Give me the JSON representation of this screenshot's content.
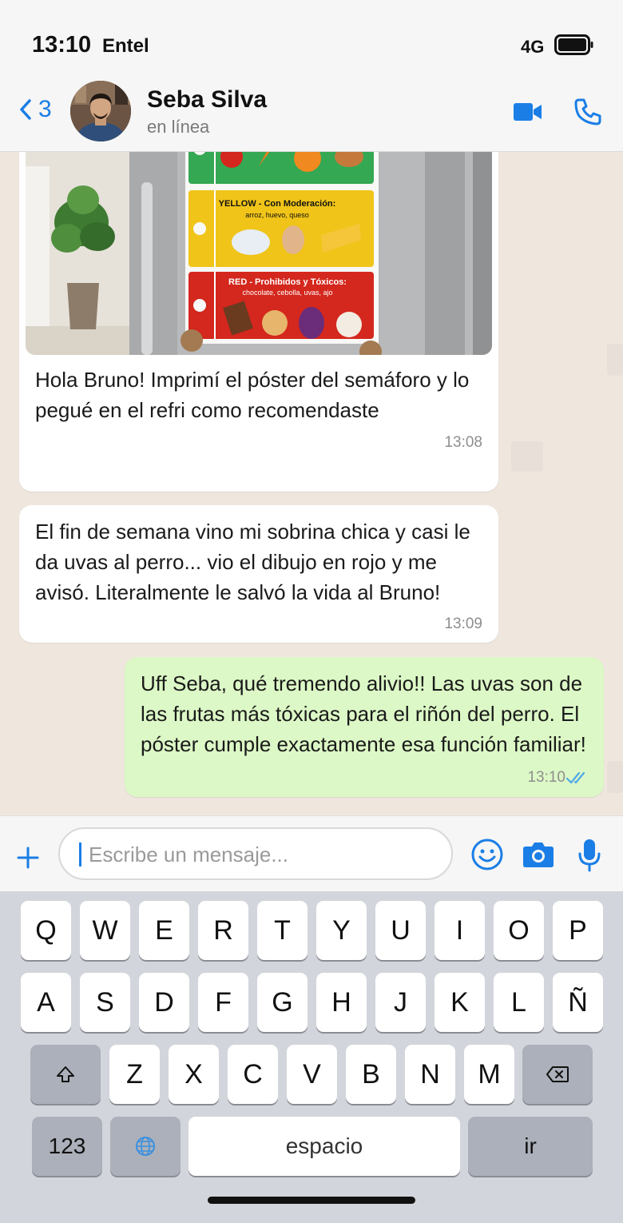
{
  "status_bar": {
    "time": "13:10",
    "carrier": "Entel",
    "network": "4G"
  },
  "header": {
    "back_count": "3",
    "contact_name": "Seba Silva",
    "contact_status": "en línea"
  },
  "messages": [
    {
      "direction": "incoming",
      "has_image": true,
      "image_poster": {
        "yellow_title": "YELLOW - Con Moderación:",
        "yellow_items": "arroz, huevo, queso",
        "red_title": "RED - Prohibidos y Tóxicos:",
        "red_items": "chocolate, cebolla, uvas, ajo"
      },
      "text": "Hola Bruno! Imprimí el póster del semáforo y lo pegué en el refri como recomendaste",
      "time": "13:08"
    },
    {
      "direction": "incoming",
      "text": "El fin de semana vino mi sobrina chica y casi le da uvas al perro... vio el dibujo en rojo y me avisó. Literalmente le salvó la vida al Bruno!",
      "time": "13:09"
    },
    {
      "direction": "outgoing",
      "text": "Uff Seba, qué tremendo alivio!! Las uvas son de las frutas más tóxicas para el riñón del perro. El póster cumple exactamente esa función familiar!",
      "time": "13:10",
      "status": "read"
    }
  ],
  "input": {
    "placeholder": "Escribe un mensaje..."
  },
  "keyboard": {
    "row1": [
      "Q",
      "W",
      "E",
      "R",
      "T",
      "Y",
      "U",
      "I",
      "O",
      "P"
    ],
    "row2": [
      "A",
      "S",
      "D",
      "F",
      "G",
      "H",
      "J",
      "K",
      "L",
      "Ñ"
    ],
    "row3": [
      "Z",
      "X",
      "C",
      "V",
      "B",
      "N",
      "M"
    ],
    "numbers_label": "123",
    "space_label": "espacio",
    "return_label": "ir"
  },
  "colors": {
    "accent": "#1a7ee6",
    "outgoing_bubble": "#dcf8c6",
    "incoming_bubble": "#ffffff",
    "chat_background": "#efe7de",
    "keyboard_background": "#d2d5db"
  },
  "icons": [
    "back-chevron-icon",
    "video-call-icon",
    "phone-icon",
    "plus-icon",
    "emoji-icon",
    "camera-icon",
    "microphone-icon",
    "shift-icon",
    "backspace-icon",
    "globe-icon",
    "battery-icon",
    "read-ticks-icon"
  ]
}
